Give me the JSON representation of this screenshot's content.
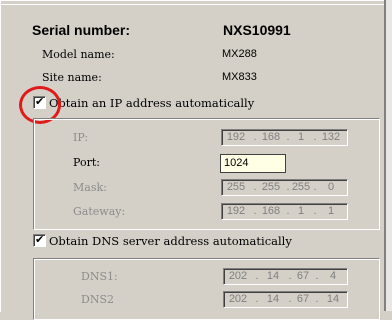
{
  "device": {
    "serial_label": "Serial number:",
    "serial_value": "NXS10991",
    "model_label": "Model name:",
    "model_value": "MX288",
    "site_label": "Site name:",
    "site_value": "MX833"
  },
  "ip_section": {
    "checkbox_label": "Obtain an IP address automatically",
    "checked": true,
    "ip_label": "IP:",
    "ip_value": [
      "192",
      "168",
      "1",
      "132"
    ],
    "port_label": "Port:",
    "port_value": "1024",
    "mask_label": "Mask:",
    "mask_value": [
      "255",
      "255",
      "255",
      "0"
    ],
    "gateway_label": "Gateway:",
    "gateway_value": [
      "192",
      "168",
      "1",
      "1"
    ]
  },
  "dns_section": {
    "checkbox_label": "Obtain DNS server address automatically",
    "checked": true,
    "dns1_label": "DNS1:",
    "dns1_value": [
      "202",
      "14",
      "67",
      "4"
    ],
    "dns2_label": "DNS2",
    "dns2_value": [
      "202",
      "14",
      "67",
      "14"
    ]
  },
  "annotation": {
    "highlight_color": "#e0191b"
  },
  "colors": {
    "background": "#d4d0c8",
    "port_field_bg": "#ffffe6",
    "disabled_text": "#8c8c8c"
  }
}
